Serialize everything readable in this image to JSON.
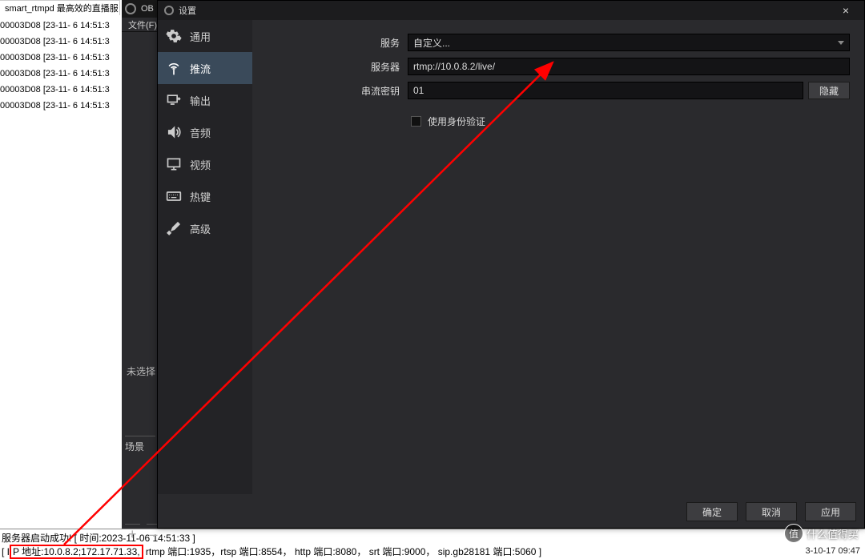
{
  "console": {
    "tab_title": "smart_rtmpd 最高效的直播服",
    "log_lines": [
      "00003D08 [23-11- 6 14:51:3",
      "00003D08 [23-11- 6 14:51:3",
      "00003D08 [23-11- 6 14:51:3",
      "00003D08 [23-11- 6 14:51:3",
      "00003D08 [23-11- 6 14:51:3",
      "00003D08 [23-11- 6 14:51:3"
    ],
    "bottom_line1_prefix": "服务器启动成功! [ 时间:2023-11-06 14:51:33 ]",
    "bottom_ip_prefix": "[ I",
    "bottom_ip_boxed": "P 地址:10.0.8.2;172.17.71.33,",
    "bottom_line2_rest": " rtmp 端口:1935，rtsp 端口:8554， http 端口:8080， srt 端口:9000， sip.gb28181 端口:5060 ]",
    "right_time": "3-10-17 09:47"
  },
  "obs": {
    "title": "OB",
    "menu_file": "文件(F)",
    "preview_text": "未选择",
    "scenes_label": "场景",
    "add_symbol": "+",
    "remove_symbol": "–"
  },
  "dlg": {
    "title": "设置",
    "close": "×",
    "sidebar": [
      {
        "label": "通用",
        "key": "general"
      },
      {
        "label": "推流",
        "key": "stream"
      },
      {
        "label": "输出",
        "key": "output"
      },
      {
        "label": "音频",
        "key": "audio"
      },
      {
        "label": "视频",
        "key": "video"
      },
      {
        "label": "热键",
        "key": "hotkeys"
      },
      {
        "label": "高级",
        "key": "advanced"
      }
    ],
    "form": {
      "service_label": "服务",
      "service_value": "自定义...",
      "server_label": "服务器",
      "server_value": "rtmp://10.0.8.2/live/",
      "key_label": "串流密钥",
      "key_value": "01",
      "hide_btn": "隐藏",
      "auth_checkbox": "使用身份验证"
    },
    "footer": {
      "ok": "确定",
      "cancel": "取消",
      "apply": "应用"
    }
  },
  "watermark": "什么值得买"
}
